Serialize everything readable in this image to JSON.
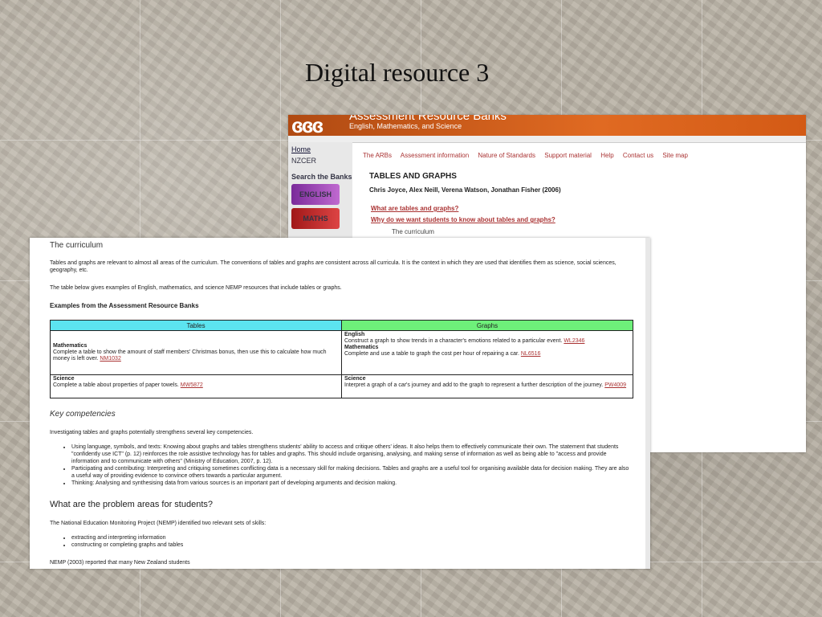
{
  "slide": {
    "title": "Digital resource 3"
  },
  "arb": {
    "logo": "ɞɞɞ",
    "site_title": "Assessment Resource Banks",
    "site_subtitle": "English, Mathematics, and Science",
    "left_nav": {
      "home": "Home",
      "nzcer": "NZCER",
      "search": "Search the Banks",
      "english_btn": "ENGLISH",
      "maths_btn": "MATHS"
    },
    "top_nav": [
      "The ARBs",
      "Assessment information",
      "Nature of Standards",
      "Support material",
      "Help",
      "Contact us",
      "Site map"
    ],
    "page_title": "TABLES AND GRAPHS",
    "authors": "Chris Joyce, Alex Neill, Verena Watson, Jonathan Fisher (2006)",
    "link_what": "What are tables and graphs?",
    "link_why": "Why do we want students to know about tables and graphs?",
    "curriculum_item": "The curriculum"
  },
  "doc": {
    "curriculum_heading": "The curriculum",
    "curriculum_p1": "Tables and graphs are relevant to almost all areas of the curriculum. The conventions of tables and graphs are consistent across all curricula. It is the context in which they are used that identifies them as science, social sciences, geography, etc.",
    "curriculum_p2": "The table below gives examples of English, mathematics, and science NEMP resources that include tables or graphs.",
    "examples_heading": "Examples from the Assessment Resource Banks",
    "table": {
      "headers": [
        "Tables",
        "Graphs"
      ],
      "row1": {
        "tables_subject": "Mathematics",
        "tables_text": "Complete a table to show the amount of staff members' Christmas bonus, then use this to calculate how much money is left over.",
        "tables_code": "NM1032",
        "graphs_subject1": "English",
        "graphs_text1": "Construct a graph to show trends in a character's emotions related to a particular event.",
        "graphs_code1": "WL2346",
        "graphs_subject2": "Mathematics",
        "graphs_text2": "Complete and use a table to graph the cost per hour of repairing a car.",
        "graphs_code2": "NL6516"
      },
      "row2": {
        "tables_subject": "Science",
        "tables_text": "Complete a table about properties of paper towels.",
        "tables_code": "MW5872",
        "graphs_subject": "Science",
        "graphs_text": "Interpret a graph of a car's journey and add to the graph to represent a further description of the journey.",
        "graphs_code": "PW4009"
      }
    },
    "key_heading": "Key competencies",
    "key_intro": "Investigating tables and graphs potentially strengthens several key competencies.",
    "key_items": [
      "Using language, symbols, and texts: Knowing about graphs and tables strengthens students' ability to access and critique others' ideas. It also helps them to effectively communicate their own. The statement that students \"confidently use ICT\" (p. 12) reinforces the role assistive technology has for tables and graphs. This should include organising, analysing, and making sense of information as well as being able to \"access and provide information and to communicate with others\" (Ministry of Education, 2007, p. 12).",
      "Participating and contributing: Interpreting and critiquing sometimes conflicting data is a necessary skill for making decisions. Tables and graphs are a useful tool for organising available data for decision making. They are also a useful way of providing evidence to convince others towards a particular argument.",
      "Thinking: Analysing and synthesising data from various sources is an important part of developing arguments and decision making."
    ],
    "problem_heading": "What are the problem areas for students?",
    "problem_intro": "The National Education Monitoring Project (NEMP) identified two relevant sets of skills:",
    "problem_items": [
      "extracting and interpreting information",
      "constructing or completing graphs and tables"
    ],
    "nemp_line": "NEMP (2003) reported that many New Zealand students"
  }
}
